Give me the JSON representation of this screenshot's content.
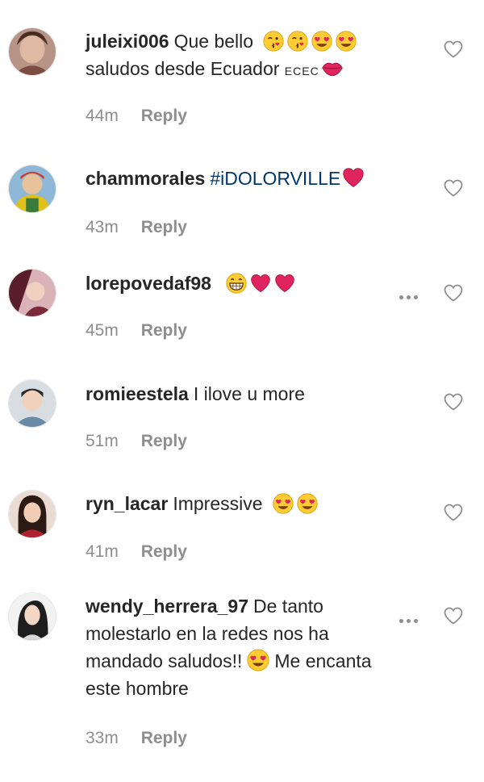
{
  "comments": [
    {
      "username": "juleixi006",
      "text1": "Que bello",
      "text2": "saludos desde Ecuador",
      "small_text": "ECEC",
      "time": "44m",
      "reply_label": "Reply",
      "emojis": [
        "kissing-wink-emoji",
        "kissing-wink-emoji",
        "heart-eyes-emoji",
        "heart-eyes-emoji",
        "kiss-lips-emoji"
      ]
    },
    {
      "username": "chammorales",
      "hashtag": "#iDOLORVILLE",
      "time": "43m",
      "reply_label": "Reply",
      "emojis": [
        "red-heart-emoji"
      ]
    },
    {
      "username": "lorepovedaf98",
      "time": "45m",
      "reply_label": "Reply",
      "emojis": [
        "grinning-emoji",
        "red-heart-emoji",
        "red-heart-emoji"
      ]
    },
    {
      "username": "romieestela",
      "text1": "I ilove u more",
      "time": "51m",
      "reply_label": "Reply"
    },
    {
      "username": "ryn_lacar",
      "text1": "Impressive",
      "time": "41m",
      "reply_label": "Reply",
      "emojis": [
        "heart-eyes-emoji",
        "heart-eyes-emoji"
      ]
    },
    {
      "username": "wendy_herrera_97",
      "text1": "De tanto molestarlo en la redes nos ha mandado saludos!!",
      "text2": "Me encanta este hombre",
      "time": "33m",
      "reply_label": "Reply",
      "emojis": [
        "heart-eyes-emoji"
      ]
    }
  ],
  "colors": {
    "text": "#262626",
    "muted": "#8e8e8e",
    "hashtag": "#00376b",
    "heart": "#e0245e"
  }
}
